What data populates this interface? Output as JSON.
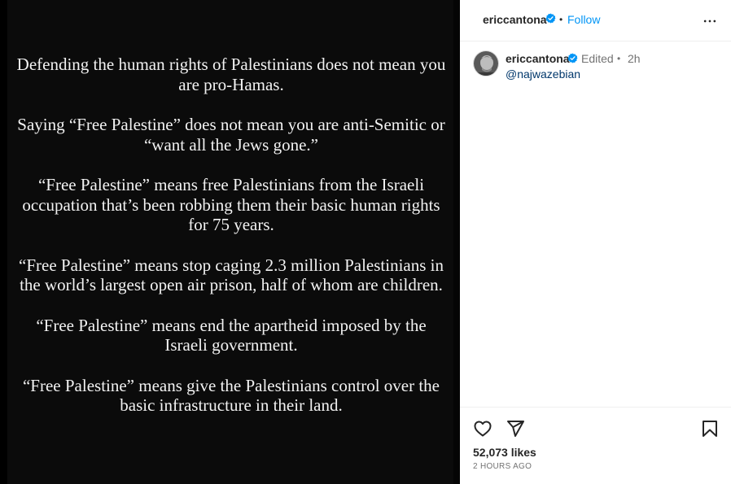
{
  "post": {
    "paragraphs": [
      "Defending the human rights of Palestinians does not mean you are pro-Hamas.",
      "Saying “Free Palestine” does not mean you are anti-Semitic or “want all the Jews gone.”",
      "“Free Palestine” means free Palestinians from the Israeli occupation that’s been robbing them their basic human rights for 75 years.",
      "“Free Palestine” means stop caging 2.3 million Palestinians in the world’s largest open air prison, half of whom are children.",
      "“Free Palestine” means end the apartheid imposed by the Israeli government.",
      "“Free Palestine” means give the Palestinians control over the basic infrastructure in their land."
    ]
  },
  "header": {
    "username": "ericcantona",
    "separator": "•",
    "follow_label": "Follow",
    "more_icon": "more-horizontal-icon"
  },
  "caption": {
    "username": "ericcantona",
    "edited_label": "Edited",
    "separator": "•",
    "time": "2h",
    "mention": "@najwazebian"
  },
  "actions": {
    "like_icon": "heart-icon",
    "share_icon": "paper-plane-icon",
    "save_icon": "bookmark-icon"
  },
  "stats": {
    "likes": "52,073 likes",
    "timestamp": "2 HOURS AGO"
  },
  "colors": {
    "accent": "#0095f6",
    "mention": "#00376b",
    "verified": "#0095f6",
    "muted": "#737373",
    "post_bg": "#0b0b0b"
  }
}
